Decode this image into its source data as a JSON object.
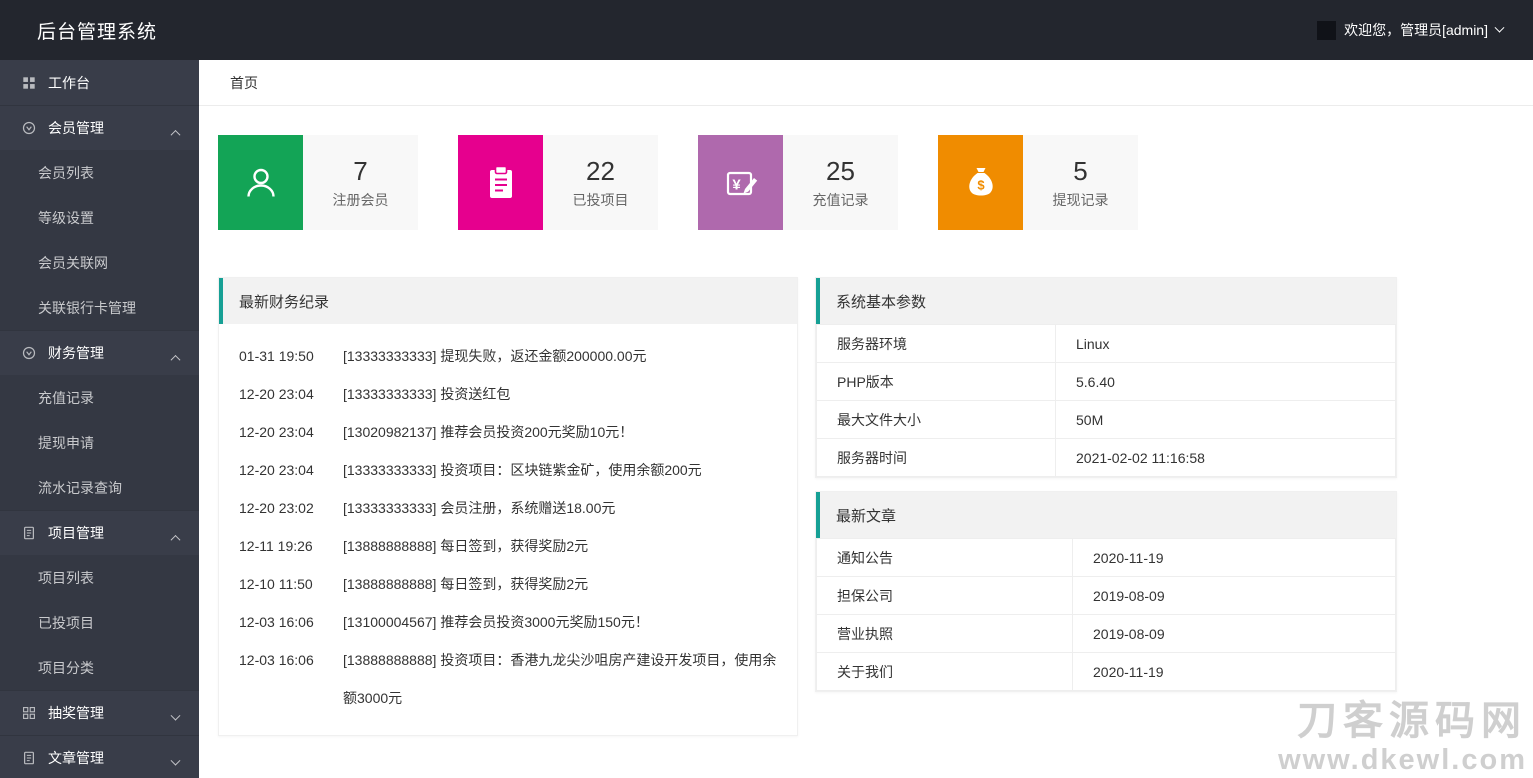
{
  "header": {
    "app_title": "后台管理系统",
    "welcome_text": "欢迎您，管理员[admin]"
  },
  "sidebar": {
    "items": [
      {
        "label": "工作台",
        "icon": "grid-icon"
      },
      {
        "label": "会员管理",
        "icon": "member-circle-icon",
        "expanded": true,
        "children": [
          "会员列表",
          "等级设置",
          "会员关联网",
          "关联银行卡管理"
        ]
      },
      {
        "label": "财务管理",
        "icon": "finance-circle-icon",
        "expanded": true,
        "children": [
          "充值记录",
          "提现申请",
          "流水记录查询"
        ]
      },
      {
        "label": "项目管理",
        "icon": "project-doc-icon",
        "expanded": true,
        "children": [
          "项目列表",
          "已投项目",
          "项目分类"
        ]
      },
      {
        "label": "抽奖管理",
        "icon": "lottery-grid-icon",
        "expanded": false,
        "children": []
      },
      {
        "label": "文章管理",
        "icon": "article-doc-icon",
        "expanded": false,
        "children": []
      }
    ]
  },
  "tabs": [
    {
      "label": "首页"
    }
  ],
  "stats": [
    {
      "value": "7",
      "label": "注册会员",
      "color": "#13a456",
      "icon": "person-icon"
    },
    {
      "value": "22",
      "label": "已投项目",
      "color": "#e6008e",
      "icon": "clipboard-icon"
    },
    {
      "value": "25",
      "label": "充值记录",
      "color": "#af69ad",
      "icon": "recharge-yen-icon"
    },
    {
      "value": "5",
      "label": "提现记录",
      "color": "#f08c00",
      "icon": "moneybag-icon"
    }
  ],
  "finance": {
    "title": "最新财务纪录",
    "records": [
      {
        "time": "01-31 19:50",
        "text": "[13333333333] 提现失败，返还金额200000.00元"
      },
      {
        "time": "12-20 23:04",
        "text": "[13333333333] 投资送红包"
      },
      {
        "time": "12-20 23:04",
        "text": "[13020982137] 推荐会员投资200元奖励10元！"
      },
      {
        "time": "12-20 23:04",
        "text": "[13333333333] 投资项目：区块链紫金矿，使用余额200元"
      },
      {
        "time": "12-20 23:02",
        "text": "[13333333333] 会员注册，系统赠送18.00元"
      },
      {
        "time": "12-11 19:26",
        "text": "[13888888888] 每日签到，获得奖励2元"
      },
      {
        "time": "12-10 11:50",
        "text": "[13888888888] 每日签到，获得奖励2元"
      },
      {
        "time": "12-03 16:06",
        "text": "[13100004567] 推荐会员投资3000元奖励150元！"
      },
      {
        "time": "12-03 16:06",
        "text": "[13888888888] 投资项目：香港九龙尖沙咀房产建设开发项目，使用余额3000元"
      }
    ]
  },
  "system": {
    "title": "系统基本参数",
    "rows": [
      {
        "key": "服务器环境",
        "value": "Linux"
      },
      {
        "key": "PHP版本",
        "value": "5.6.40"
      },
      {
        "key": "最大文件大小",
        "value": "50M"
      },
      {
        "key": "服务器时间",
        "value": "2021-02-02 11:16:58"
      }
    ]
  },
  "articles": {
    "title": "最新文章",
    "rows": [
      {
        "key": "通知公告",
        "value": "2020-11-19"
      },
      {
        "key": "担保公司",
        "value": "2019-08-09"
      },
      {
        "key": "营业执照",
        "value": "2019-08-09"
      },
      {
        "key": "关于我们",
        "value": "2020-11-19"
      }
    ]
  },
  "watermark": {
    "line1": "刀客源码网",
    "line2": "www.dkewl.com"
  },
  "colors": {
    "header_bg": "#23262e",
    "sidebar_bg": "#393d49",
    "panel_header_bg": "#f2f2f2",
    "accent_teal": "#16a095"
  }
}
